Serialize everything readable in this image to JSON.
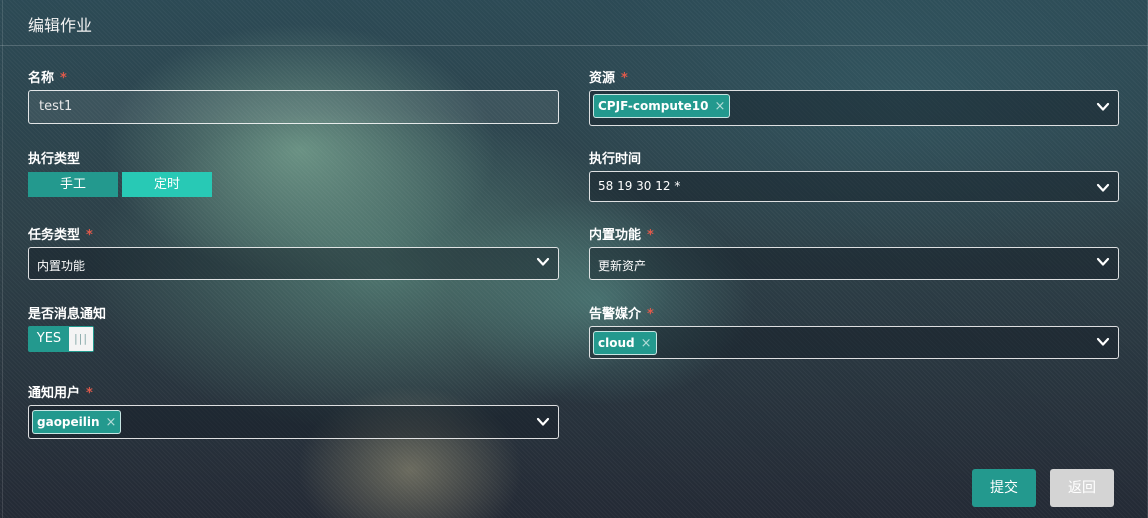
{
  "header": {
    "title": "编辑作业"
  },
  "form": {
    "name": {
      "label": "名称",
      "required": "*",
      "value": "test1"
    },
    "resource": {
      "label": "资源",
      "required": "*",
      "tags": [
        "CPJF-compute10"
      ]
    },
    "exec_type": {
      "label": "执行类型",
      "options": [
        "手工",
        "定时"
      ],
      "selected": "定时"
    },
    "exec_time": {
      "label": "执行时间",
      "value": "58 19 30 12 *"
    },
    "task_type": {
      "label": "任务类型",
      "required": "*",
      "value": "内置功能"
    },
    "builtin": {
      "label": "内置功能",
      "required": "*",
      "value": "更新资产"
    },
    "notify": {
      "label": "是否消息通知",
      "toggle_label": "YES",
      "knob": "|||"
    },
    "alert_media": {
      "label": "告警媒介",
      "required": "*",
      "tags": [
        "cloud"
      ]
    },
    "notify_user": {
      "label": "通知用户",
      "required": "*",
      "tags": [
        "gaopeilin"
      ]
    }
  },
  "icons": {
    "tag_remove": "×",
    "dropdown": "chevron-down-icon"
  },
  "actions": {
    "submit": "提交",
    "back": "返回"
  },
  "colors": {
    "accent": "#23998e",
    "selected_segment": "#28c9b5",
    "required": "#e05a4b",
    "back_button": "#d4d4d4"
  }
}
